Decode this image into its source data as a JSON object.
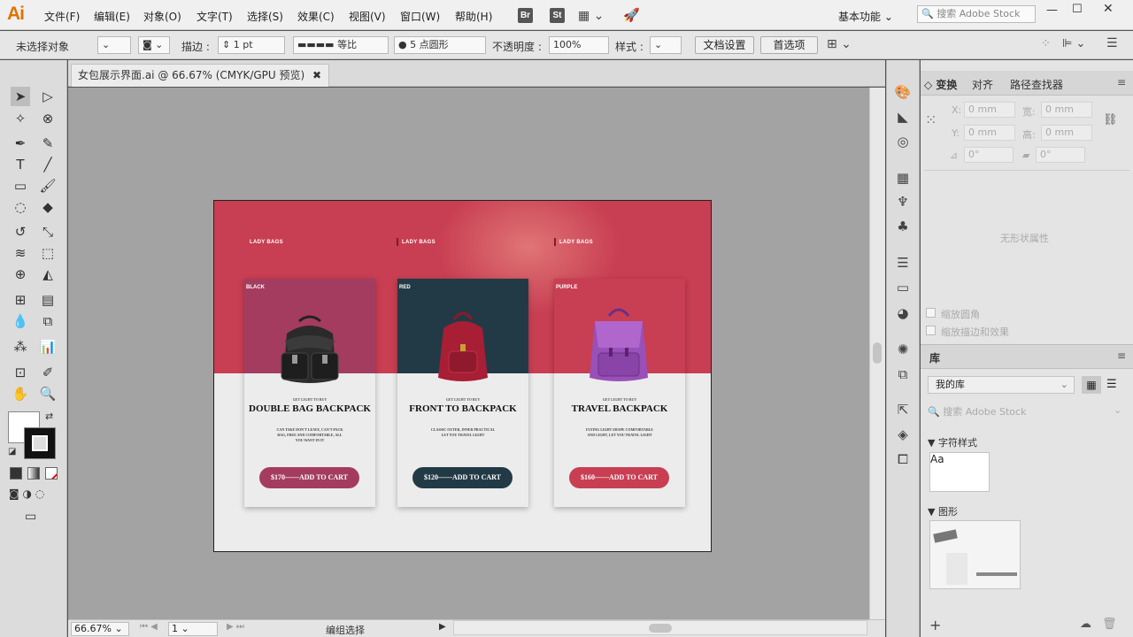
{
  "app": {
    "logo": "Ai",
    "workspace": "基本功能",
    "search_placeholder": "搜索 Adobe Stock"
  },
  "menus": [
    "文件(F)",
    "编辑(E)",
    "对象(O)",
    "文字(T)",
    "选择(S)",
    "效果(C)",
    "视图(V)",
    "窗口(W)",
    "帮助(H)"
  ],
  "bridge": [
    "Br",
    "St"
  ],
  "options": {
    "selection": "未选择对象",
    "stroke_label": "描边 :",
    "stroke_value": "1 pt",
    "profile": "等比",
    "brush": "5 点圆形",
    "opacity_label": "不透明度 :",
    "opacity_value": "100%",
    "style_label": "样式 :",
    "doc_setup": "文档设置",
    "prefs": "首选项"
  },
  "document": {
    "tab_title": "女包展示界面.ai @ 66.67% (CMYK/GPU 预览)"
  },
  "status": {
    "zoom": "66.67%",
    "page": "1",
    "mode": "编组选择"
  },
  "panel": {
    "tabs": [
      "变换",
      "对齐",
      "路径查找器"
    ],
    "x_label": "X:",
    "y_label": "Y:",
    "w_label": "宽:",
    "h_label": "高:",
    "x_val": "0 mm",
    "y_val": "0 mm",
    "w_val": "0 mm",
    "h_val": "0 mm",
    "angle": "0°",
    "shear": "0°",
    "no_shape": "无形状属性",
    "scale_corners": "缩放圆角",
    "scale_strokes": "缩放描边和效果"
  },
  "library": {
    "title": "库",
    "selected": "我的库",
    "search_placeholder": "搜索 Adobe Stock",
    "char_styles": "字符样式",
    "char_sample": "Aa",
    "graphics": "图形"
  },
  "artboard": {
    "lady": [
      "LADY BAGS",
      "LADY BAGS",
      "LADY BAGS"
    ],
    "cards": [
      {
        "color_label": "BLACK",
        "kicker": "GET LIGHT TO BUY",
        "title": "DOUBLE BAG BACKPACK",
        "desc": "CAN TAKE DON'T LEAVE, CAN'T PACK BAG, FREE AND COMFORTABLE, ALL YOU WANT IN IT",
        "button": "$170——ADD TO CART",
        "top_color": "#a43c60",
        "btn_color": "#a43c60",
        "bag_color": "#2a2a2a"
      },
      {
        "color_label": "RED",
        "kicker": "GET LIGHT TO BUY",
        "title": "FRONT TO BACKPACK",
        "desc": "CLASSIC OUTER, INNER PRACTICAL LET YOU TRAVEL LIGHT",
        "button": "$120——ADD TO CART",
        "top_color": "#223a46",
        "btn_color": "#223a46",
        "bag_color": "#a71e35"
      },
      {
        "color_label": "PURPLE",
        "kicker": "GET LIGHT TO BUY",
        "title": "TRAVEL BACKPACK",
        "desc": "FLYING LIGHT SHAPE COMFORTABLE AND LIGHT, LET YOU TRAVEL LIGHT",
        "button": "$160——ADD TO CART",
        "top_color": "#c83e52",
        "btn_color": "#c83e52",
        "bag_color": "#9950b8"
      }
    ]
  }
}
